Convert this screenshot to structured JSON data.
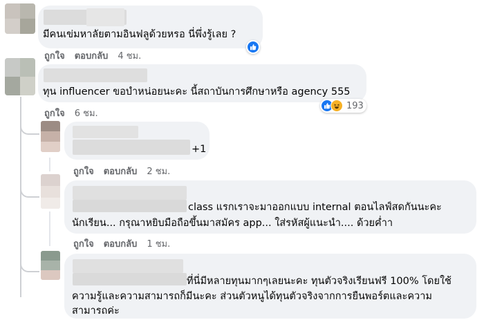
{
  "comments": [
    {
      "text": "มีคนเข่มหาลัยตามอินฟลูด้วยหรอ นี่พึ่งรู้เลย ?",
      "like": "ถูกใจ",
      "reply": "ตอบกลับ",
      "time": "4 ชม."
    },
    {
      "text": "ทุน influencer ขอบำหน่อยนะคะ นี้สถาบันการศึกษาหรือ agency 555",
      "like": "ถูกใจ",
      "time": "6 ชม.",
      "reaction_count": "193"
    }
  ],
  "replies": [
    {
      "text": "+1",
      "like": "ถูกใจ",
      "reply": "ตอบกลับ",
      "time": "2 ชม."
    },
    {
      "line1": "class แรกเราจะมาออกแบบ internal ตอนไลฟ์สดกันนะคะ",
      "line2": "นักเรียน... กรุณาหยิบมือถือขึ้นมาสมัคร app... ใส่รหัสผู้แนะนำ.... ด้วยค่ำา",
      "like": "ถูกใจ",
      "reply": "ตอบกลับ",
      "time": "1 ชม."
    },
    {
      "line1": "ที่นี่มีหลายทุนมากๆเลยนะคะ ทุนตัวจริงเรียนฟรี 100% โดยใช้",
      "line2": "ความรู้และความสามารถก็มีนะคะ ส่วนตัวหนูได้ทุนตัวจริงจากการยืนพอร์ตและความ",
      "line3": "สามารถค่ะ"
    }
  ],
  "colors": {
    "bubble": "#f0f2f5",
    "meta_text": "#65676b",
    "like_blue": "#1877f2",
    "haha_yellow": "#f7b125",
    "thread_line": "#ced0d4"
  }
}
